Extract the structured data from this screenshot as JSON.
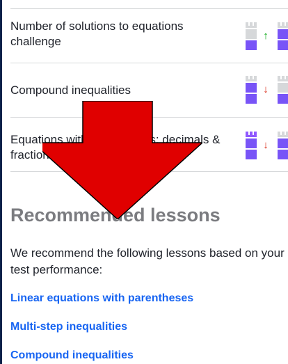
{
  "skills": [
    {
      "name": "Number of solutions to equations challenge",
      "change": "up",
      "change_glyph": "↑",
      "change_color": "#00a60e",
      "before": {
        "crown": "#d6d8da",
        "mid": "#d6d8da",
        "base": "#7854f7"
      },
      "after": {
        "crown": "#d6d8da",
        "mid": "#7854f7",
        "base": "#7854f7"
      }
    },
    {
      "name": "Compound inequalities",
      "change": "down",
      "change_glyph": "↓",
      "change_color": "#d92916",
      "before": {
        "crown": "#d6d8da",
        "mid": "#7854f7",
        "base": "#7854f7"
      },
      "after": {
        "crown": "#d6d8da",
        "mid": "#d6d8da",
        "base": "#7854f7"
      }
    },
    {
      "name": "Equations with parentheses: decimals & fractions",
      "change": "down",
      "change_glyph": "↓",
      "change_color": "#d92916",
      "before": {
        "crown": "#9059ff",
        "mid": "#7854f7",
        "base": "#7854f7"
      },
      "after": {
        "crown": "#d6d8da",
        "mid": "#7854f7",
        "base": "#7854f7"
      }
    }
  ],
  "recommended": {
    "title": "Recommended lessons",
    "description": "We recommend the following lessons based on your test performance:",
    "lessons": [
      "Linear equations with parentheses",
      "Multi-step inequalities",
      "Compound inequalities"
    ]
  },
  "colors": {
    "link": "#1865f2",
    "mastered": "#7854f7",
    "empty": "#d6d8da",
    "overlay_arrow": "#e00000"
  },
  "overlay": {
    "icon": "big-red-down-arrow-icon"
  }
}
